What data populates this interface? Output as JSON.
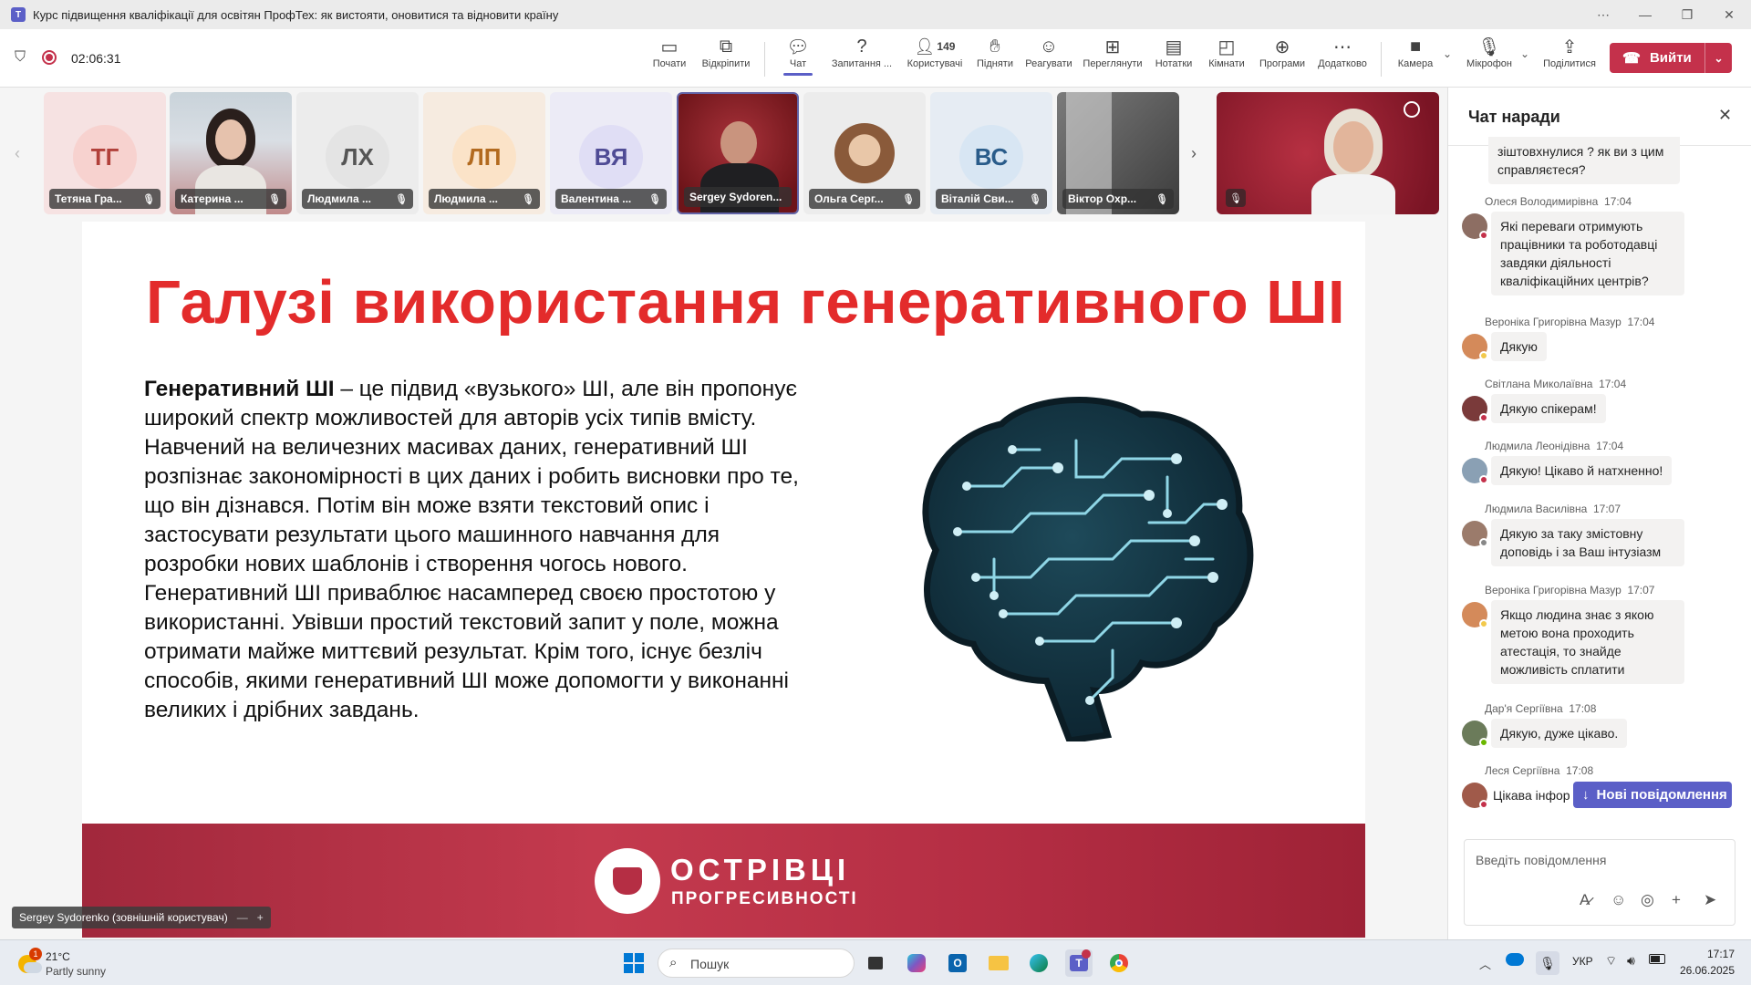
{
  "window": {
    "title": "Курс підвищення кваліфікації для освітян ПрофТех: як вистояти, оновитися та відновити країну"
  },
  "meeting": {
    "timer": "02:06:31"
  },
  "toolbar": {
    "items": [
      {
        "label": "Почати",
        "icon": "present-icon"
      },
      {
        "label": "Відкріпити",
        "icon": "popout-icon"
      },
      {
        "label": "Чат",
        "icon": "chat-icon"
      },
      {
        "label": "Запитання ...",
        "icon": "qa-icon"
      },
      {
        "label": "Користувачі",
        "icon": "people-icon",
        "count": "149"
      },
      {
        "label": "Підняти",
        "icon": "hand-icon"
      },
      {
        "label": "Реагувати",
        "icon": "emoji-icon"
      },
      {
        "label": "Переглянути",
        "icon": "view-icon"
      },
      {
        "label": "Нотатки",
        "icon": "notes-icon"
      },
      {
        "label": "Кімнати",
        "icon": "rooms-icon"
      },
      {
        "label": "Програми",
        "icon": "apps-icon"
      },
      {
        "label": "Додатково",
        "icon": "more-icon"
      },
      {
        "label": "Камера",
        "icon": "camera-icon"
      },
      {
        "label": "Мікрофон",
        "icon": "mic-off-icon"
      },
      {
        "label": "Поділитися",
        "icon": "share-icon"
      }
    ],
    "leave_label": "Вийти",
    "accent": "#c4314b"
  },
  "participants": [
    {
      "name": "Тетяна Гра...",
      "initials": "ТГ",
      "bg": "#f6e2e2",
      "av": "#f7d2cf",
      "fg": "#b1403a"
    },
    {
      "name": "Катерина ...",
      "initials": "",
      "bg": "#c7d2d8",
      "photo": true
    },
    {
      "name": "Людмила ...",
      "initials": "ЛХ",
      "bg": "#ececec",
      "av": "#e4e4e4",
      "fg": "#555"
    },
    {
      "name": "Людмила ...",
      "initials": "ЛП",
      "bg": "#f6ebe0",
      "av": "#fbe3c8",
      "fg": "#b26a1f"
    },
    {
      "name": "Валентина ...",
      "initials": "ВЯ",
      "bg": "#ecebf6",
      "av": "#e0def5",
      "fg": "#4f4b95"
    },
    {
      "name": "Sergey Sydoren...",
      "initials": "",
      "bg": "#7c1d22",
      "photo": true
    },
    {
      "name": "Ольга Серг...",
      "initials": "",
      "bg": "#ececec",
      "photo": true
    },
    {
      "name": "Віталій Сви...",
      "initials": "ВС",
      "bg": "#e6ecf3",
      "av": "#d8e6f3",
      "fg": "#2a5c8a"
    },
    {
      "name": "Віктор Охр...",
      "initials": "",
      "bg": "#5a5a5a",
      "photo": true
    }
  ],
  "slide": {
    "title": "Галузі використання генеративного ШІ",
    "body_bold": "Генеративний ШІ",
    "body_rest": " – це підвид «вузького» ШІ, але він пропонує широкий спектр можливостей для авторів усіх типів вмісту. Навчений на величезних масивах даних, генеративний ШІ розпізнає закономірності в цих даних і робить висновки про те, що він дізнався. Потім він може взяти текстовий опис і застосувати результати цього машинного навчання для розробки нових шаблонів і створення чогось нового. Генеративний ШІ приваблює насамперед своєю простотою у використанні. Увівши простий текстовий запит у поле, можна отримати майже миттєвий результат. Крім того, існує безліч способів, якими генеративний ШІ може допомогти у виконанні великих і дрібних завдань.",
    "footer_logo_line1": "ОСТРІВЦІ",
    "footer_logo_line2": "ПРОГРЕСИВНОСТІ",
    "title_color": "#e32b2b"
  },
  "presenter_label": "Sergey Sydorenko (зовнішній користувач)",
  "chat": {
    "title": "Чат наради",
    "messages": [
      {
        "author": "",
        "time": "",
        "text": "зіштовхнулися ? як ви з цим справляєтеся?"
      },
      {
        "author": "Олеся Володимирівна",
        "time": "17:04",
        "text": "Які переваги отримують працівники та роботодавці завдяки діяльності кваліфікаційних центрів?"
      },
      {
        "author": "Вероніка Григорівна Мазур",
        "time": "17:04",
        "text": "Дякую"
      },
      {
        "author": "Світлана Миколаївна",
        "time": "17:04",
        "text": "Дякую спікерам!"
      },
      {
        "author": "Людмила Леонідівна",
        "time": "17:04",
        "text": "Дякую! Цікаво й натхненно!"
      },
      {
        "author": "Людмила Василівна",
        "time": "17:07",
        "text": "Дякую за таку змістовну доповідь і за Ваш інтузіазм"
      },
      {
        "author": "Вероніка Григорівна Мазур",
        "time": "17:07",
        "text": "Якщо людина знає з якою метою вона проходить атестація, то знайде можливість сплатити"
      },
      {
        "author": "Дар'я Сергіївна",
        "time": "17:08",
        "text": "Дякую, дуже цікаво."
      },
      {
        "author": "Леся Сергіївна",
        "time": "17:08",
        "text": "Цікава інфор"
      }
    ],
    "new_messages_label": "Нові повідомлення",
    "compose_placeholder": "Введіть повідомлення"
  },
  "taskbar": {
    "weather_temp": "21°C",
    "weather_desc": "Partly sunny",
    "weather_badge": "1",
    "search_placeholder": "Пошук",
    "language": "УКР",
    "time": "17:17",
    "date": "26.06.2025"
  }
}
